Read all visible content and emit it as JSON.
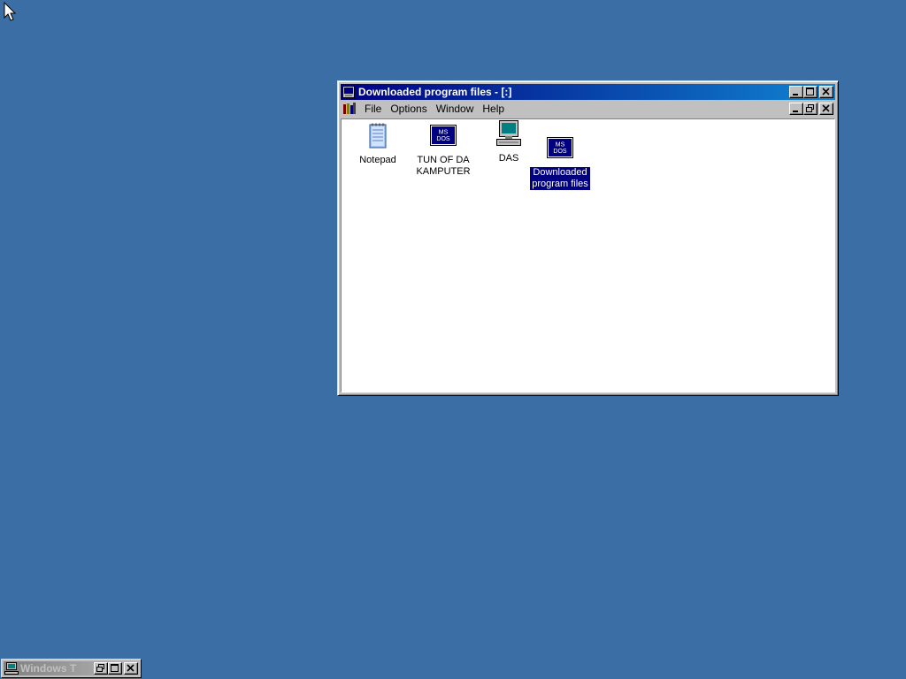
{
  "window": {
    "title": "Downloaded program files - [:]",
    "menu": [
      "File",
      "Options",
      "Window",
      "Help"
    ]
  },
  "icons": [
    {
      "label_line1": "Notepad",
      "label_line2": "",
      "icon": "notepad-icon"
    },
    {
      "label_line1": "TUN OF DA",
      "label_line2": "KAMPUTER",
      "icon": "msdos-icon"
    },
    {
      "label_line1": "DAS",
      "label_line2": "",
      "icon": "computer-icon"
    },
    {
      "label_line1": "Downloaded",
      "label_line2": "program files",
      "icon": "msdos-icon",
      "selected": true
    }
  ],
  "minimized": {
    "title": "Windows T"
  },
  "colors": {
    "desktop": "#3a6ea5",
    "titlebar_start": "#000080",
    "titlebar_end": "#1084d0",
    "selection": "#000080"
  }
}
